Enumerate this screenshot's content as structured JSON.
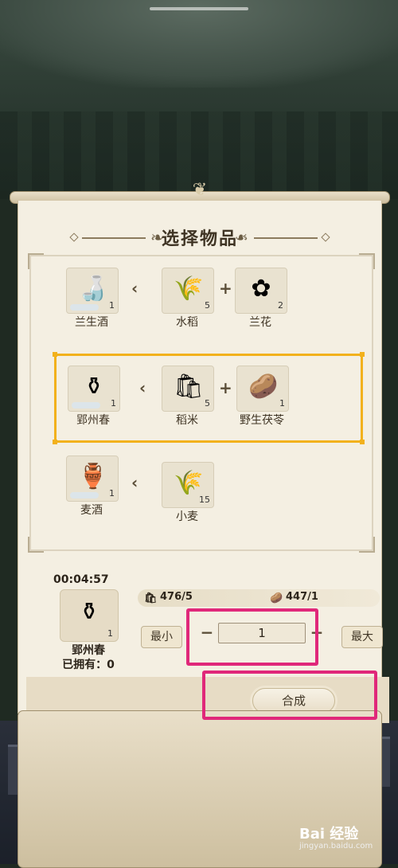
{
  "panel": {
    "title": "选择物品"
  },
  "recipes": [
    {
      "product": {
        "name": "兰生酒",
        "count": "1",
        "icon": "wine-gourd-icon"
      },
      "ingredients": [
        {
          "name": "水稻",
          "count": "5",
          "icon": "rice-plant-icon"
        },
        {
          "name": "兰花",
          "count": "2",
          "icon": "orchid-icon"
        }
      ]
    },
    {
      "product": {
        "name": "郢州春",
        "count": "1",
        "icon": "wine-jar-icon"
      },
      "ingredients": [
        {
          "name": "稻米",
          "count": "5",
          "icon": "rice-sack-icon"
        },
        {
          "name": "野生茯苓",
          "count": "1",
          "icon": "poria-icon"
        }
      ]
    },
    {
      "product": {
        "name": "麦酒",
        "count": "1",
        "icon": "wine-pot-icon"
      },
      "ingredients": [
        {
          "name": "小麦",
          "count": "15",
          "icon": "wheat-icon"
        }
      ]
    }
  ],
  "detail": {
    "timer": "00:04:57",
    "item_name": "郢州春",
    "item_count": "1",
    "owned_label": "已拥有：",
    "owned_value": "0",
    "resources": [
      {
        "value": "476/5",
        "icon": "rice-sack-icon"
      },
      {
        "value": "447/1",
        "icon": "poria-icon"
      }
    ],
    "min_label": "最小",
    "max_label": "最大",
    "minus": "−",
    "plus": "+",
    "quantity": "1",
    "craft_label": "合成"
  },
  "watermark": {
    "brand": "Bai 经验",
    "url": "jingyan.baidu.com"
  },
  "colors": {
    "highlight": "#e0287a",
    "selected_border": "#f2b11c"
  }
}
